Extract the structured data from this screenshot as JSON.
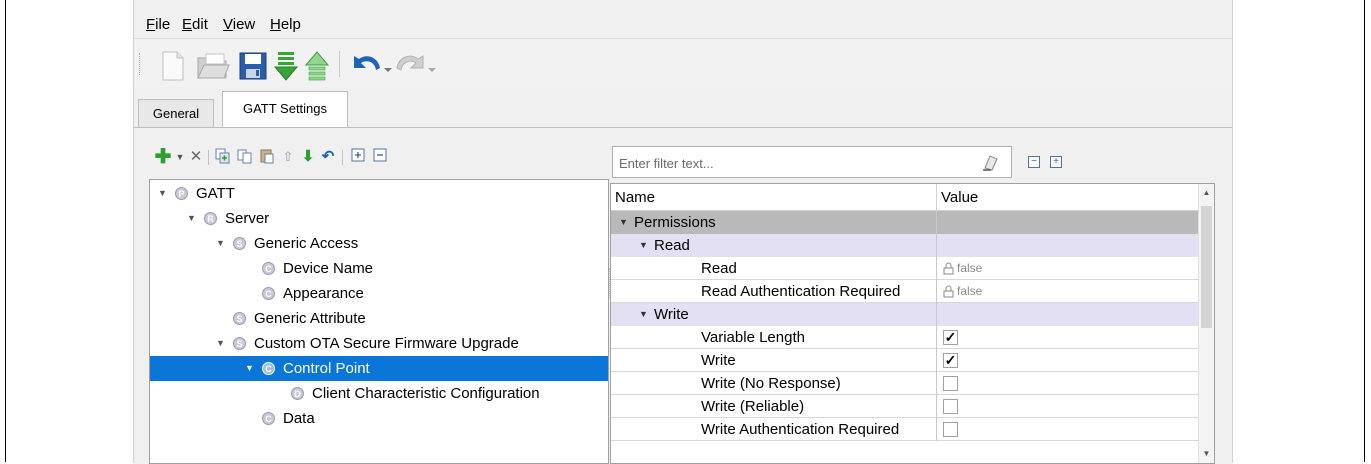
{
  "menu": {
    "file": "File",
    "file_u": "F",
    "edit": "Edit",
    "edit_u": "E",
    "view": "View",
    "view_u": "V",
    "help": "Help",
    "help_u": "H"
  },
  "toolbar": {
    "items": [
      "new-file-icon",
      "open-folder-icon",
      "save-icon",
      "import-icon",
      "export-icon",
      "undo-icon",
      "redo-icon"
    ]
  },
  "tabs": [
    {
      "label": "General",
      "active": false
    },
    {
      "label": "GATT Settings",
      "active": true
    }
  ],
  "tree": [
    {
      "label": "GATT",
      "badge": "P",
      "level": 0,
      "expanded": true
    },
    {
      "label": "Server",
      "badge": "R",
      "level": 1,
      "expanded": true
    },
    {
      "label": "Generic Access",
      "badge": "S",
      "level": 2,
      "expanded": true
    },
    {
      "label": "Device Name",
      "badge": "C",
      "level": 3
    },
    {
      "label": "Appearance",
      "badge": "C",
      "level": 3
    },
    {
      "label": "Generic Attribute",
      "badge": "S",
      "level": 2
    },
    {
      "label": "Custom OTA Secure Firmware Upgrade",
      "badge": "S",
      "level": 2,
      "expanded": true
    },
    {
      "label": "Control Point",
      "badge": "C",
      "level": 3,
      "expanded": true,
      "selected": true
    },
    {
      "label": "Client Characteristic Configuration",
      "badge": "D",
      "level": 4
    },
    {
      "label": "Data",
      "badge": "C",
      "level": 3
    }
  ],
  "filter": {
    "placeholder": "Enter filter text..."
  },
  "grid": {
    "col_name": "Name",
    "col_value": "Value",
    "rows": [
      {
        "name": "Permissions",
        "kind": "cat0",
        "indent": 0
      },
      {
        "name": "Read",
        "kind": "cat",
        "indent": 1
      },
      {
        "name": "Read",
        "kind": "locked",
        "value": "false",
        "indent": 2
      },
      {
        "name": "Read Authentication Required",
        "kind": "locked",
        "value": "false",
        "indent": 2
      },
      {
        "name": "Write",
        "kind": "cat",
        "indent": 1
      },
      {
        "name": "Variable Length",
        "kind": "check",
        "checked": true,
        "indent": 2
      },
      {
        "name": "Write",
        "kind": "check",
        "checked": true,
        "indent": 2
      },
      {
        "name": "Write (No Response)",
        "kind": "check",
        "checked": false,
        "indent": 2
      },
      {
        "name": "Write (Reliable)",
        "kind": "check",
        "checked": false,
        "indent": 2
      },
      {
        "name": "Write Authentication Required",
        "kind": "check",
        "checked": false,
        "indent": 2
      }
    ]
  },
  "colors": {
    "selection": "#0a76d8",
    "category": "#e2e0f2",
    "top_category": "#b9b9b9",
    "add_icon": "#2e9e2e",
    "arrow_green": "#3aa33a",
    "undo_blue": "#1d64b8"
  }
}
